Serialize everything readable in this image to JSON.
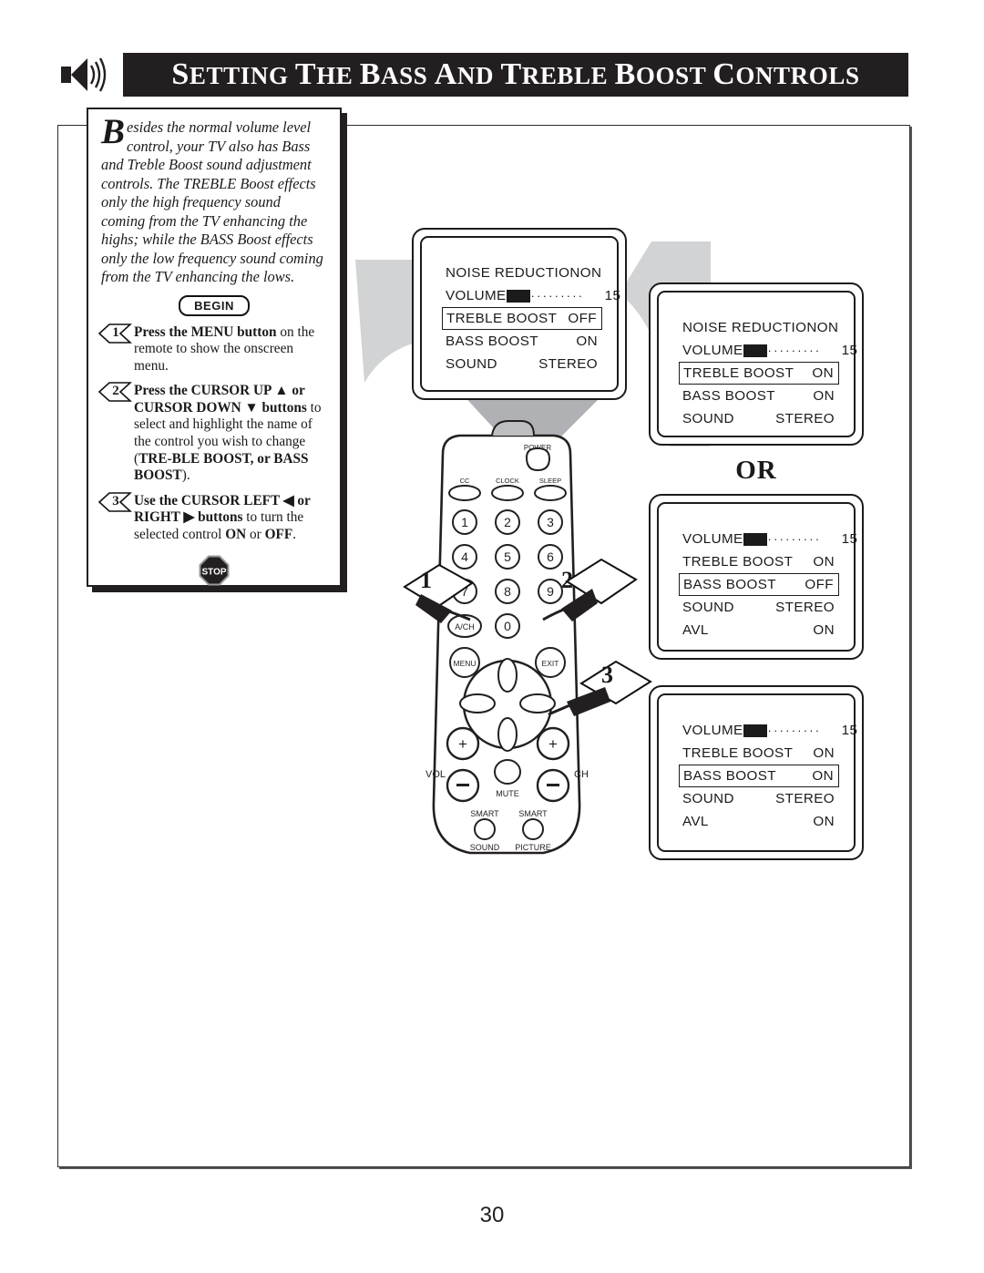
{
  "header": {
    "title_words": [
      "Setting",
      "the",
      "Bass",
      "and",
      "Treble",
      "Boost",
      "Controls"
    ],
    "title": "SETTING THE BASS AND TREBLE BOOST CONTROLS",
    "icon": "speaker-sound-icon"
  },
  "instructions": {
    "dropcap": "B",
    "intro": "esides the normal volume level control, your TV also has Bass and Treble Boost sound adjustment controls. The TREBLE Boost effects only the high frequency sound coming from the TV enhancing the highs; while the BASS Boost effects only the low frequency sound coming from the TV enhancing the lows.",
    "begin_label": "BEGIN",
    "stop_label": "STOP",
    "steps": [
      {
        "number": "1",
        "bold_lead": "Press the MENU button",
        "rest": " on the remote to show the onscreen menu."
      },
      {
        "number": "2",
        "bold_lead": "Press the CURSOR UP ▲ or CURSOR DOWN ▼ buttons",
        "rest": " to select and highlight the name of the control you wish to change (",
        "bold_tail": "TRE-BLE BOOST, or BASS BOOST",
        "tail_end": ")."
      },
      {
        "number": "3",
        "bold_lead": "Use the CURSOR LEFT ◀ or RIGHT ▶ buttons",
        "rest": " to turn the selected control ",
        "bold_on": "ON",
        "mid": " or ",
        "bold_off": "OFF",
        "tail_end": "."
      }
    ]
  },
  "or_label": "OR",
  "screens": [
    {
      "name": "screen-treble-off",
      "rows": [
        {
          "label": "NOISE REDUCTION",
          "value": "ON",
          "type": "text",
          "highlight": false
        },
        {
          "label": "VOLUME",
          "value": "15",
          "type": "slider",
          "highlight": false,
          "dots": 9
        },
        {
          "label": "TREBLE BOOST",
          "value": "OFF",
          "type": "text",
          "highlight": true
        },
        {
          "label": "BASS BOOST",
          "value": "ON",
          "type": "text",
          "highlight": false
        },
        {
          "label": "SOUND",
          "value": "STEREO",
          "type": "text",
          "highlight": false
        }
      ]
    },
    {
      "name": "screen-treble-on",
      "rows": [
        {
          "label": "NOISE REDUCTION",
          "value": "ON",
          "type": "text",
          "highlight": false
        },
        {
          "label": "VOLUME",
          "value": "15",
          "type": "slider",
          "highlight": false,
          "dots": 9
        },
        {
          "label": "TREBLE BOOST",
          "value": "ON",
          "type": "text",
          "highlight": true
        },
        {
          "label": "BASS BOOST",
          "value": "ON",
          "type": "text",
          "highlight": false
        },
        {
          "label": "SOUND",
          "value": "STEREO",
          "type": "text",
          "highlight": false
        }
      ]
    },
    {
      "name": "screen-bass-off",
      "rows": [
        {
          "label": "VOLUME",
          "value": "15",
          "type": "slider",
          "highlight": false,
          "dots": 9
        },
        {
          "label": "TREBLE BOOST",
          "value": "ON",
          "type": "text",
          "highlight": false
        },
        {
          "label": "BASS BOOST",
          "value": "OFF",
          "type": "text",
          "highlight": true
        },
        {
          "label": "SOUND",
          "value": "STEREO",
          "type": "text",
          "highlight": false
        },
        {
          "label": "AVL",
          "value": "ON",
          "type": "text",
          "highlight": false
        }
      ]
    },
    {
      "name": "screen-bass-on",
      "rows": [
        {
          "label": "VOLUME",
          "value": "15",
          "type": "slider",
          "highlight": false,
          "dots": 9
        },
        {
          "label": "TREBLE BOOST",
          "value": "ON",
          "type": "text",
          "highlight": false
        },
        {
          "label": "BASS BOOST",
          "value": "ON",
          "type": "text",
          "highlight": true
        },
        {
          "label": "SOUND",
          "value": "STEREO",
          "type": "text",
          "highlight": false
        },
        {
          "label": "AVL",
          "value": "ON",
          "type": "text",
          "highlight": false
        }
      ]
    }
  ],
  "remote": {
    "power_label": "POWER",
    "top_buttons": [
      "CC",
      "CLOCK",
      "SLEEP"
    ],
    "keypad": [
      "1",
      "2",
      "3",
      "4",
      "5",
      "6",
      "7",
      "8",
      "9",
      "A/CH",
      "0"
    ],
    "menu_label": "MENU",
    "exit_label": "EXIT",
    "vol_label": "VOL",
    "ch_label": "CH",
    "mute_label": "MUTE",
    "smart_sound": [
      "SMART",
      "SOUND"
    ],
    "smart_picture": [
      "SMART",
      "PICTURE"
    ],
    "plus": "+",
    "minus": "–"
  },
  "callouts": [
    "1",
    "2",
    "3"
  ],
  "page_number": "30",
  "colors": {
    "ink": "#231f20",
    "shadow_grey": "#a7a9ac",
    "paper": "#ffffff"
  }
}
